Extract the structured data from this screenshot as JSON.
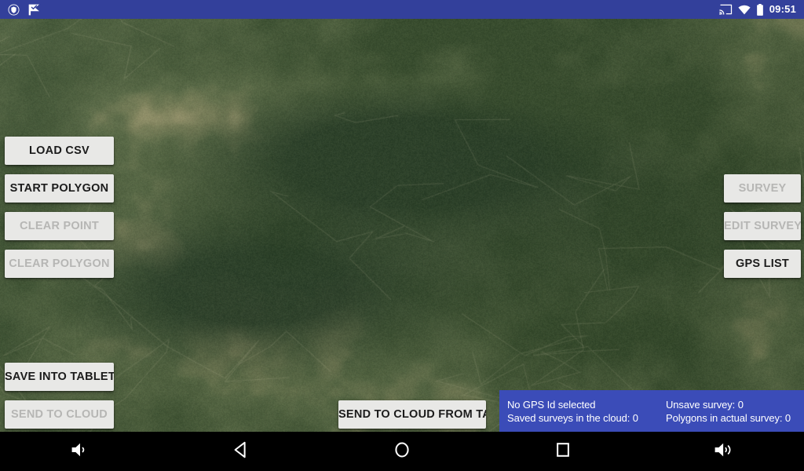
{
  "status_bar": {
    "background_color": "#33409b",
    "left_icons": [
      {
        "name": "shield-security-icon",
        "label": "Security"
      },
      {
        "name": "checkmark-flag-icon",
        "label": "Tasks"
      }
    ],
    "right_icons": [
      {
        "name": "cast-screen-icon",
        "label": "Cast"
      },
      {
        "name": "wifi-icon",
        "label": "Wi-Fi"
      },
      {
        "name": "battery-icon",
        "label": "Battery"
      }
    ],
    "clock": "09:51"
  },
  "map": {
    "name": "satellite-map",
    "type": "satellite-imagery",
    "palette": {
      "base": "#6d7a54",
      "forest_dark": "#1e3320",
      "forest_mid": "#364a2c",
      "field_tan": "#9c9169",
      "field_light": "#b6ab84",
      "haze": "#7d8a6a"
    }
  },
  "buttons": {
    "left": [
      {
        "id": "load-csv",
        "label": "LOAD CSV",
        "enabled": true
      },
      {
        "id": "start-polygon",
        "label": "START POLYGON",
        "enabled": true
      },
      {
        "id": "clear-point",
        "label": "CLEAR POINT",
        "enabled": false
      },
      {
        "id": "clear-polygon",
        "label": "CLEAR POLYGON",
        "enabled": false
      }
    ],
    "left_bottom": [
      {
        "id": "save-into-tablet",
        "label": "SAVE INTO TABLET",
        "enabled": true
      },
      {
        "id": "send-to-cloud",
        "label": "SEND TO CLOUD",
        "enabled": false
      }
    ],
    "right": [
      {
        "id": "survey",
        "label": "SURVEY",
        "enabled": false
      },
      {
        "id": "edit-survey",
        "label": "EDIT SURVEY",
        "enabled": false
      },
      {
        "id": "gps-list",
        "label": "GPS LIST",
        "enabled": true
      }
    ],
    "center_bottom": {
      "id": "send-to-cloud-from-tablet",
      "label": "SEND TO CLOUD FROM TABLET",
      "enabled": true
    }
  },
  "info_panel": {
    "background_color": "#3b4cb8",
    "text_color": "#ffffff",
    "column_1": [
      "No GPS Id selected",
      "Saved surveys in the cloud: 0"
    ],
    "column_2": [
      "Unsave survey: 0",
      "Polygons in actual survey: 0"
    ]
  },
  "nav_bar": {
    "background_color": "#000000",
    "items": [
      {
        "id": "volume-down",
        "name": "volume-down-icon",
        "label": "Volume down"
      },
      {
        "id": "back",
        "name": "back-triangle-icon",
        "label": "Back"
      },
      {
        "id": "home",
        "name": "home-circle-icon",
        "label": "Home"
      },
      {
        "id": "recents",
        "name": "recents-square-icon",
        "label": "Recent apps"
      },
      {
        "id": "volume-up",
        "name": "volume-up-icon",
        "label": "Volume up"
      }
    ]
  }
}
